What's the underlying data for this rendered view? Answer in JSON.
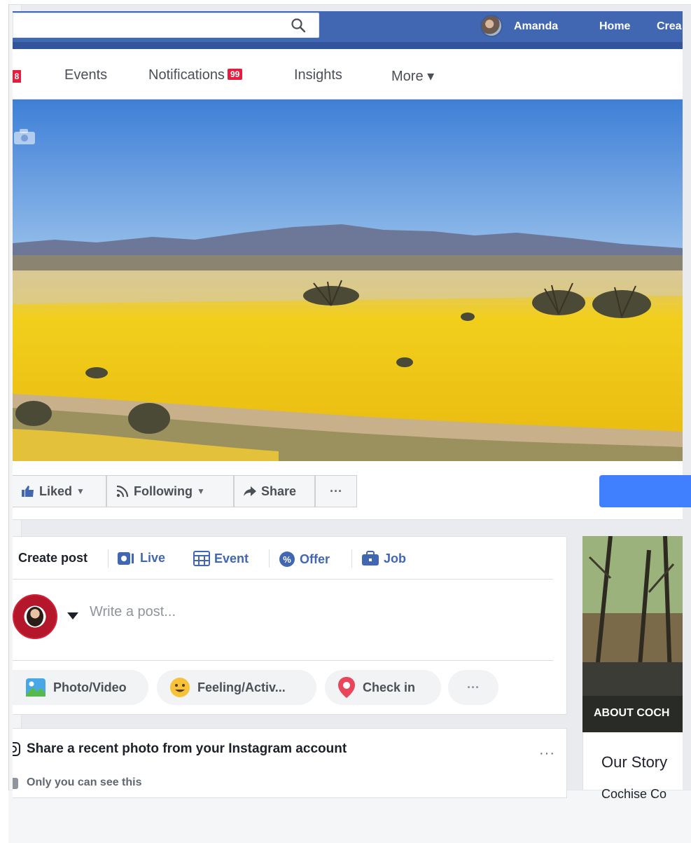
{
  "topbar": {
    "search_placeholder": "",
    "user_name": "Amanda",
    "home_label": "Home",
    "create_label": "Crea"
  },
  "page_nav": {
    "left_badge": "8",
    "items": [
      {
        "label": "Events"
      },
      {
        "label": "Notifications",
        "badge": "99"
      },
      {
        "label": "Insights"
      },
      {
        "label": "More ▾"
      }
    ]
  },
  "actions": {
    "liked_label": "Liked",
    "following_label": "Following",
    "share_label": "Share",
    "more_label": "···"
  },
  "composer": {
    "tabs": [
      {
        "label": "Create post"
      },
      {
        "label": "Live"
      },
      {
        "label": "Event"
      },
      {
        "label": "Offer"
      },
      {
        "label": "Job"
      }
    ],
    "write_placeholder": "Write a post...",
    "attachments": [
      {
        "label": "Photo/Video"
      },
      {
        "label": "Feeling/Activ..."
      },
      {
        "label": "Check in"
      },
      {
        "label": "···"
      }
    ]
  },
  "instagram_card": {
    "title": "Share a recent photo from your Instagram account",
    "visibility": "Only you can see this",
    "more": "···"
  },
  "sidebar": {
    "about_label": "ABOUT COCH",
    "story_title": "Our Story",
    "story_text": "Cochise Co"
  },
  "colors": {
    "brand_blue": "#4267b2",
    "badge_red": "#e41e3f",
    "cta_blue": "#4080ff"
  }
}
